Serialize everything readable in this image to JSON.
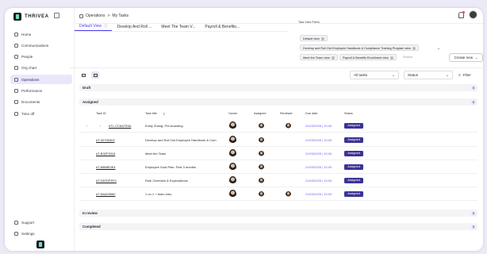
{
  "app": {
    "name": "THRIVEA"
  },
  "sidebar": {
    "items": [
      {
        "label": "Home",
        "icon": "home-icon",
        "active": false
      },
      {
        "label": "Communications",
        "icon": "chat-icon",
        "active": false
      },
      {
        "label": "People",
        "icon": "people-icon",
        "active": false
      },
      {
        "label": "Org chart",
        "icon": "org-chart-icon",
        "active": false
      },
      {
        "label": "Operations",
        "icon": "operations-icon",
        "active": true
      },
      {
        "label": "Performance",
        "icon": "performance-icon",
        "active": false
      },
      {
        "label": "Documents",
        "icon": "document-icon",
        "active": false
      },
      {
        "label": "Time off",
        "icon": "calendar-icon",
        "active": false
      }
    ],
    "bottom_items": [
      {
        "label": "Support",
        "icon": "support-icon"
      },
      {
        "label": "Settings",
        "icon": "settings-icon"
      }
    ]
  },
  "breadcrumb": {
    "section": "Operations",
    "separator": ">",
    "page": "My Tasks"
  },
  "tabs": [
    {
      "label": "Default View",
      "active": true
    },
    {
      "label": "Develop And Roll ...",
      "active": false
    },
    {
      "label": "Meet The Team V...",
      "active": false
    },
    {
      "label": "Payroll & Benefits...",
      "active": false
    }
  ],
  "view_filters": {
    "label": "Task View Filters",
    "chips": [
      "Default view",
      "Develop and Roll Out Employee Handbook & Compliance Training Program view",
      "Meet the Team view",
      "Payroll & Benefits Enrollment view"
    ],
    "search_placeholder": "Search"
  },
  "create_button": {
    "label": "Create new"
  },
  "toolbar": {
    "task_filter": "All tasks",
    "status_filter": "Status",
    "filter_label": "Filter"
  },
  "sections": {
    "draft": {
      "label": "Draft",
      "count": "0"
    },
    "assigned": {
      "label": "Assigned",
      "count": "6"
    },
    "in_review": {
      "label": "In review",
      "count": "0"
    },
    "completed": {
      "label": "Completed",
      "count": "0"
    }
  },
  "table": {
    "columns": [
      "Task ID",
      "Task title",
      "Owner",
      "Assignee",
      "Reviewer",
      "Due date",
      "Status"
    ],
    "rows": [
      {
        "id": "#TL-CC6A753A",
        "title": "Emily Zhang: Pre-boarding",
        "due": "31/03/2025 | 10:00",
        "status": "Assigned"
      },
      {
        "id": "#T-00705403",
        "title": "Develop and Roll Out Employee Handbook & Com",
        "due": "21/03/2025 | 10:00",
        "status": "Assigned"
      },
      {
        "id": "#T-B32F3016",
        "title": "Meet the Team",
        "due": "21/03/2025 | 10:00",
        "status": "Assigned"
      },
      {
        "id": "#T-8588E0E4",
        "title": "Employee Goal Plan: First 3 months",
        "due": "21/03/2025 | 10:00",
        "status": "Assigned"
      },
      {
        "id": "#T-D57DFEF4",
        "title": "Role Overview & Expectations",
        "due": "21/03/2025 | 10:00",
        "status": "Assigned"
      },
      {
        "id": "#T-5A623B60",
        "title": "1 on 1 + team intro",
        "due": "21/03/2025 | 10:00",
        "status": "Assigned"
      }
    ]
  },
  "colors": {
    "accent": "#4b3df0",
    "badge": "#3b3394",
    "active_nav": "#ebe7fb"
  }
}
